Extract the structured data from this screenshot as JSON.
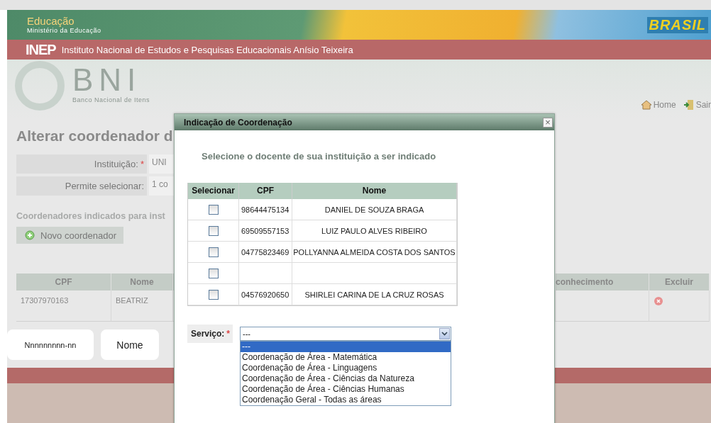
{
  "header": {
    "title": "Educação",
    "subtitle": "Ministério da Educação",
    "brand": "BRASIL"
  },
  "inep_bar": {
    "logo": "INEP",
    "title": "Instituto Nacional de Estudos e Pesquisas Educacionais Anísio Teixeira"
  },
  "bni": {
    "logo": "BNI",
    "subtitle": "Banco Nacional de Itens"
  },
  "nav": [
    {
      "label": "Home",
      "kind": "home"
    },
    {
      "label": "Sair",
      "kind": "exit"
    }
  ],
  "page": {
    "title": "Alterar coordenador d",
    "fields": [
      {
        "label": "Instituição:",
        "required_mark": "*",
        "value": "UNI"
      },
      {
        "label": "Permite selecionar:",
        "value": "1 co"
      }
    ],
    "section_title": "Coordenadores indicados para inst",
    "new_button": "Novo coordenador",
    "table": {
      "columns": [
        "CPF",
        "Nome",
        "conhecimento",
        "Excluir"
      ],
      "rows": [
        {
          "cpf": "17307970163",
          "nome": "BEATRIZ"
        }
      ]
    }
  },
  "callouts": [
    "Nnnnnnnnn-nn",
    "Nome"
  ],
  "dialog": {
    "title": "Indicação de Coordenação",
    "close": "×",
    "instruction": "Selecione o docente de sua instituição a ser indicado",
    "columns": [
      "Selecionar",
      "CPF",
      "Nome"
    ],
    "rows": [
      {
        "checked": false,
        "cpf": "98644475134",
        "nome": "DANIEL DE SOUZA BRAGA"
      },
      {
        "checked": false,
        "cpf": "69509557153",
        "nome": "LUIZ PAULO ALVES RIBEIRO"
      },
      {
        "checked": false,
        "cpf": "04775823469",
        "nome": "POLLYANNA ALMEIDA COSTA DOS SANTOS"
      },
      {
        "checked": false
      },
      {
        "checked": false,
        "cpf": "04576920650",
        "nome": "SHIRLEI CARINA DE LA CRUZ ROSAS"
      }
    ],
    "service": {
      "label": "Serviço:",
      "required_mark": "*",
      "value": "---",
      "expanded": true,
      "options": [
        {
          "label": "---",
          "selected": true
        },
        {
          "label": "Coordenação de Área - Matemática",
          "selected": false
        },
        {
          "label": "Coordenação de Área - Linguagens",
          "selected": false
        },
        {
          "label": "Coordenação de Área - Ciências da Natureza",
          "selected": false
        },
        {
          "label": "Coordenação de Área - Ciências Humanas",
          "selected": false
        },
        {
          "label": "Coordenação Geral - Todas as áreas",
          "selected": false
        }
      ]
    }
  }
}
